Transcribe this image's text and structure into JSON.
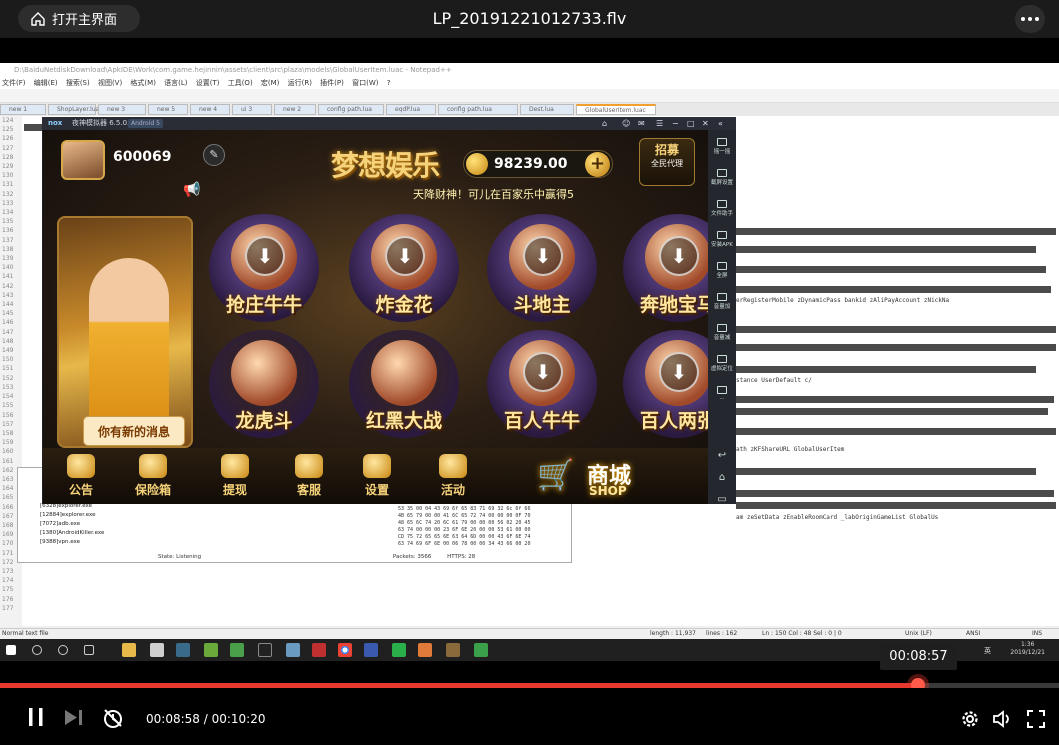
{
  "header": {
    "home_label": "打开主界面",
    "title": "LP_20191221012733.flv"
  },
  "notepad": {
    "title": "D:\\BaiduNetdiskDownload\\ApkIDE\\Work\\com.game.hejinnin\\assets\\client\\src\\plaza\\models\\GlobalUserItem.luac - Notepad++",
    "menu": "文件(F) 编辑(E) 搜索(S) 视图(V) 格式(M) 语言(L) 设置(T) 工具(O) 宏(M) 运行(R) 插件(P) 窗口(W) ?",
    "tabs": [
      "new 1",
      "ShopLayer.lua",
      "new 3",
      "new 5",
      "new 4",
      "ui 3",
      "new 2",
      "config path.lua",
      "eqdP.lua",
      "config path.lua",
      "Dest.lua",
      "GlobalUserItem.luac"
    ],
    "line_start": 124,
    "code_snippets": [
      "erRegisterMobile  zDynamicPass  bankid  zAliPayAccount  zNickNa",
      "stance  UserDefault  c/  ",
      "ath  zKFShareURL  GlobalUserItem",
      "am  zeSetData  zEnableRoomCard  _labOriginGameList  GlobalUs"
    ],
    "status": {
      "file_type": "Normal text file",
      "length": "length : 11,937",
      "lines": "lines : 162",
      "position": "Ln : 150    Col : 48    Sel : 0 | 0",
      "eol": "Unix (LF)",
      "encoding": "ANSI",
      "mode": "INS"
    }
  },
  "fiddler": {
    "processes": [
      "[6328]explorer.exe",
      "[12884]explorer.exe",
      "[7072]adb.exe",
      "[1380]AndroidKiller.exe",
      "[9388]vpn.exe"
    ],
    "status_text": "State: Listening",
    "packets": "Packets: 3566",
    "https": "HTTPS: 28",
    "hex": "53 35 00 04 43 69 6f 65 83 71 69 32 6c 6f 66\n4B 65 79 00 00 41 6C 65 72 74 00 00 00 0F 70\n48 65 6C 74 20 6C 61 79 00 00 00 56 02 20 45\n63 74 00 00 00 23 6F 6E 20 00 00 53 61 00 00\nCD 75 72 65 65 6E 63 64 6D 00 00 43 6F 6E 74\n63 74 69 6F 6E 00 06 78 00 00 34 43 66 00 20"
  },
  "nox": {
    "brand": "nox",
    "version": "夜神模拟器 6.5.0.0",
    "android": "Android 5",
    "sidebar": [
      {
        "icon": "shake-icon",
        "label": "摇一摇"
      },
      {
        "icon": "screenshot-icon",
        "label": "截屏设置"
      },
      {
        "icon": "file-helper-icon",
        "label": "文件助手"
      },
      {
        "icon": "install-apk-icon",
        "label": "安装APK"
      },
      {
        "icon": "fullscreen-icon",
        "label": "全屏"
      },
      {
        "icon": "volume-up-icon",
        "label": "音量加"
      },
      {
        "icon": "volume-down-icon",
        "label": "音量减"
      },
      {
        "icon": "virtual-location-icon",
        "label": "虚拟定位"
      },
      {
        "icon": "more-icon",
        "label": "..."
      }
    ]
  },
  "game": {
    "user_id": "600069",
    "title": "梦想娱乐",
    "coins": "98239.00",
    "agent_label": "招募",
    "agent_sub": "全民代理",
    "marquee": "天降财神！可儿在百家乐中赢得5",
    "message_bubble": "你有新的消息",
    "games": [
      "抢庄牛牛",
      "炸金花",
      "斗地主",
      "奔驰宝马",
      "龙虎斗",
      "红黑大战",
      "百人牛牛",
      "百人两张"
    ],
    "nav": [
      {
        "icon": "announcement-icon",
        "label": "公告"
      },
      {
        "icon": "safe-box-icon",
        "label": "保险箱"
      },
      {
        "icon": "withdraw-icon",
        "label": "提现"
      },
      {
        "icon": "customer-service-icon",
        "label": "客服"
      },
      {
        "icon": "settings-gear-icon",
        "label": "设置"
      },
      {
        "icon": "gift-icon",
        "label": "活动"
      }
    ],
    "shop_label": "商城",
    "shop_sub": "SHOP"
  },
  "taskbar": {
    "ime": "英",
    "time": "1:36",
    "date": "2019/12/21"
  },
  "player": {
    "hover_time": "00:08:57",
    "current_time": "00:08:58",
    "total_time": "00:10:20",
    "progress": 0.867,
    "accent_color": "#e8382e"
  }
}
